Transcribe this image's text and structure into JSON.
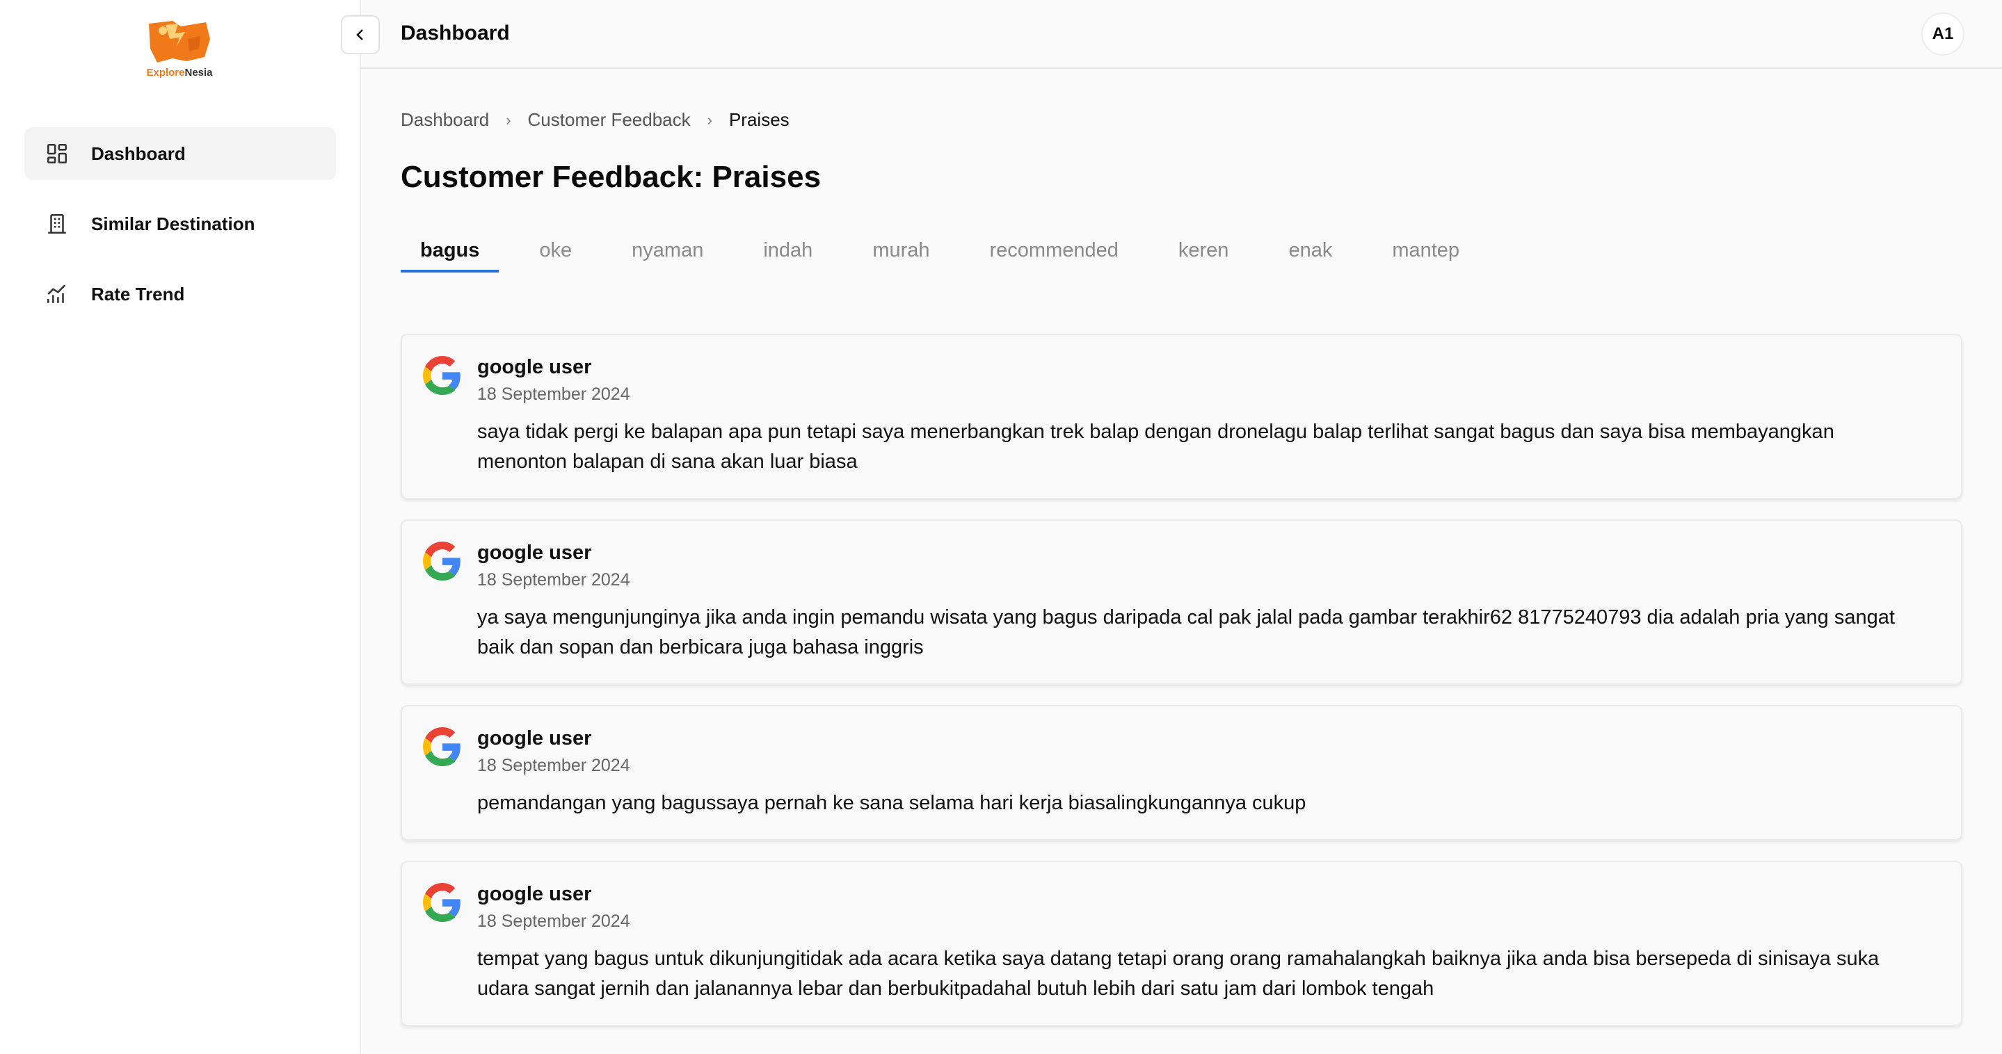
{
  "brand": {
    "part1": "Explore",
    "part2": "Nesia"
  },
  "sidebar": {
    "items": [
      {
        "label": "Dashboard",
        "icon": "dashboard-icon",
        "active": true
      },
      {
        "label": "Similar Destination",
        "icon": "building-icon",
        "active": false
      },
      {
        "label": "Rate Trend",
        "icon": "chart-icon",
        "active": false
      }
    ]
  },
  "topbar": {
    "title": "Dashboard",
    "avatar": "A1"
  },
  "breadcrumb": [
    "Dashboard",
    "Customer Feedback",
    "Praises"
  ],
  "page_title": "Customer Feedback: Praises",
  "tabs": [
    "bagus",
    "oke",
    "nyaman",
    "indah",
    "murah",
    "recommended",
    "keren",
    "enak",
    "mantep"
  ],
  "active_tab": "bagus",
  "reviews": [
    {
      "user": "google user",
      "date": "18 September 2024",
      "text": "saya tidak pergi ke balapan apa pun tetapi saya menerbangkan trek balap dengan dronelagu balap terlihat sangat bagus dan saya bisa membayangkan menonton balapan di sana akan luar biasa"
    },
    {
      "user": "google user",
      "date": "18 September 2024",
      "text": "ya saya mengunjunginya jika anda ingin pemandu wisata yang bagus daripada cal pak jalal pada gambar terakhir62 81775240793 dia adalah pria yang sangat baik dan sopan dan berbicara juga bahasa inggris"
    },
    {
      "user": "google user",
      "date": "18 September 2024",
      "text": "pemandangan yang bagussaya pernah ke sana selama hari kerja biasalingkungannya cukup"
    },
    {
      "user": "google user",
      "date": "18 September 2024",
      "text": "tempat yang bagus untuk dikunjungitidak ada acara ketika saya datang tetapi orang orang ramahalangkah baiknya jika anda bisa bersepeda di sinisaya suka udara sangat jernih dan jalanannya lebar dan berbukitpadahal butuh lebih dari satu jam dari lombok tengah"
    }
  ],
  "colors": {
    "accent": "#2a6fdb",
    "brand_orange": "#f07a1a"
  }
}
